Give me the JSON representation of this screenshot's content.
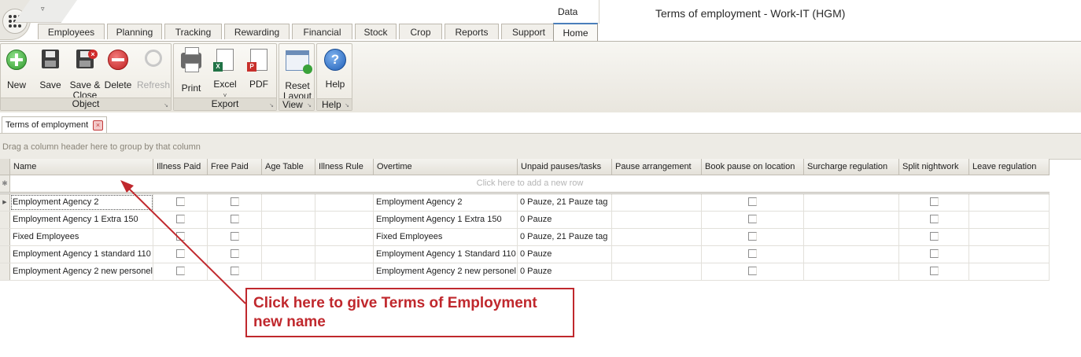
{
  "window": {
    "title": "Terms of employment - Work-IT (HGM)",
    "context_label": "Data"
  },
  "ribbon_tabs": [
    "Employees",
    "Planning",
    "Tracking",
    "Rewarding",
    "Financial",
    "Stock",
    "Crop",
    "Reports",
    "Support"
  ],
  "active_tab": "Home",
  "ribbon": {
    "object": {
      "label": "Object",
      "new": "New",
      "save": "Save",
      "save_close": "Save & Close",
      "delete": "Delete",
      "refresh": "Refresh"
    },
    "export": {
      "label": "Export",
      "print": "Print",
      "excel": "Excel",
      "pdf": "PDF"
    },
    "view": {
      "label": "View",
      "reset_layout": "Reset Layout"
    },
    "help": {
      "label": "Help",
      "help": "Help"
    }
  },
  "document_tab": "Terms of employment",
  "group_panel_hint": "Drag a column header here to group by that column",
  "grid": {
    "columns": [
      "Name",
      "Illness Paid",
      "Free Paid",
      "Age Table",
      "Illness Rule",
      "Overtime",
      "Unpaid pauses/tasks",
      "Pause arrangement",
      "Book pause on location",
      "Surcharge regulation",
      "Split nightwork",
      "Leave regulation"
    ],
    "new_row_hint": "Click here to add a new row",
    "rows": [
      {
        "name": "Employment Agency 2",
        "illness_paid": false,
        "free_paid": false,
        "age_table": "",
        "illness_rule": "",
        "overtime": "Employment Agency 2",
        "unpaid_pauses": "0 Pauze, 21 Pauze tag",
        "pause_arrangement": "",
        "book_pause": false,
        "surcharge": "",
        "split_nightwork": false,
        "leave_regulation": ""
      },
      {
        "name": "Employment Agency 1 Extra 150",
        "illness_paid": false,
        "free_paid": false,
        "age_table": "",
        "illness_rule": "",
        "overtime": "Employment Agency 1 Extra 150",
        "unpaid_pauses": "0 Pauze",
        "pause_arrangement": "",
        "book_pause": false,
        "surcharge": "",
        "split_nightwork": false,
        "leave_regulation": ""
      },
      {
        "name": "Fixed Employees",
        "illness_paid": false,
        "free_paid": false,
        "age_table": "",
        "illness_rule": "",
        "overtime": "Fixed Employees",
        "unpaid_pauses": "0 Pauze, 21 Pauze tag",
        "pause_arrangement": "",
        "book_pause": false,
        "surcharge": "",
        "split_nightwork": false,
        "leave_regulation": ""
      },
      {
        "name": "Employment Agency 1 standard 110",
        "illness_paid": false,
        "free_paid": false,
        "age_table": "",
        "illness_rule": "",
        "overtime": "Employment Agency 1 Standard 110",
        "unpaid_pauses": "0 Pauze",
        "pause_arrangement": "",
        "book_pause": false,
        "surcharge": "",
        "split_nightwork": false,
        "leave_regulation": ""
      },
      {
        "name": "Employment Agency 2 new personel",
        "illness_paid": false,
        "free_paid": false,
        "age_table": "",
        "illness_rule": "",
        "overtime": "Employment Agency 2 new personel",
        "unpaid_pauses": "0 Pauze",
        "pause_arrangement": "",
        "book_pause": false,
        "surcharge": "",
        "split_nightwork": false,
        "leave_regulation": ""
      }
    ]
  },
  "annotation": {
    "text_line1": "Click here to give Terms of Employment",
    "text_line2": "new name",
    "color": "#c0282d"
  },
  "icons": [
    "app-menu-icon",
    "quick-access-dropdown-icon",
    "new-icon",
    "save-icon",
    "save-close-icon",
    "delete-icon",
    "refresh-icon",
    "print-icon",
    "excel-icon",
    "pdf-icon",
    "reset-layout-icon",
    "help-icon",
    "close-tab-icon"
  ]
}
